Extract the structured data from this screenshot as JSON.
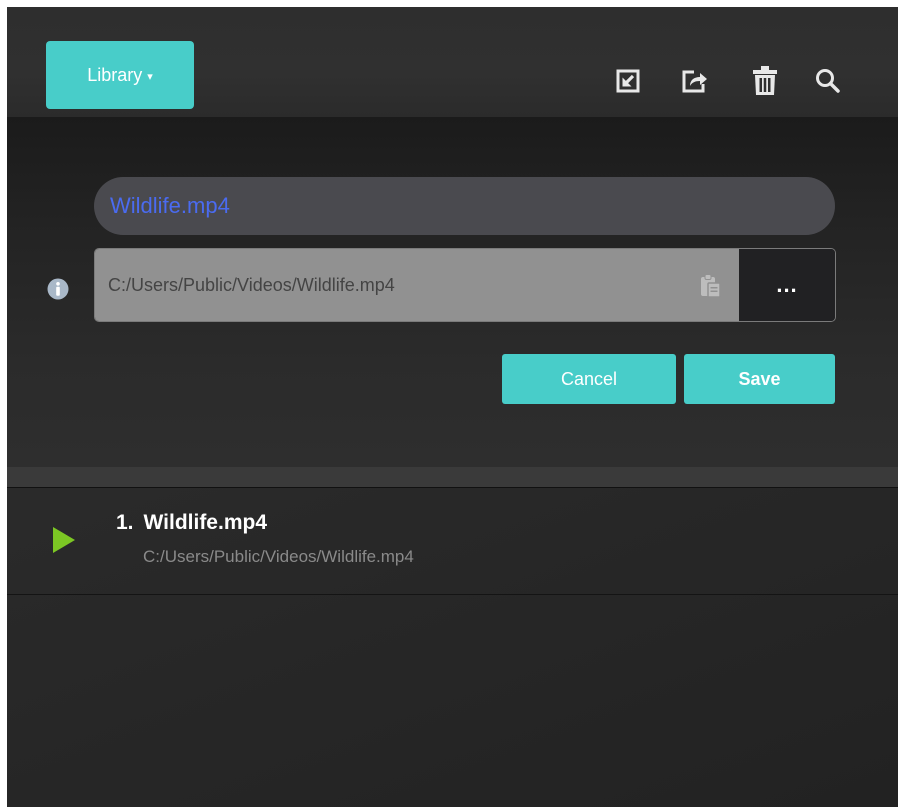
{
  "header": {
    "library_label": "Library",
    "library_caret": "▾",
    "icons": [
      "import-icon",
      "export-icon",
      "trash-icon",
      "search-icon"
    ]
  },
  "editor": {
    "name_value": "Wildlife.mp4",
    "path_value": "C:/Users/Public/Videos/Wildlife.mp4",
    "browse_label": "...",
    "cancel_label": "Cancel",
    "save_label": "Save",
    "name_color": "#4a6bf0"
  },
  "playlist": {
    "items": [
      {
        "number": "1.",
        "title": "Wildlife.mp4",
        "path": "C:/Users/Public/Videos/Wildlife.mp4"
      }
    ]
  },
  "colors": {
    "accent": "#48cdc9",
    "play": "#7cc724",
    "background": "#2b2b2b"
  }
}
